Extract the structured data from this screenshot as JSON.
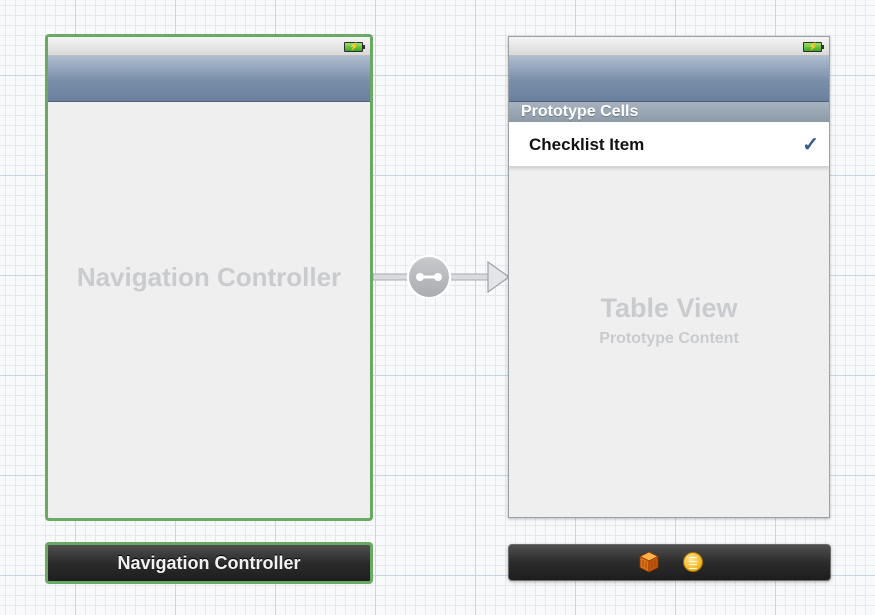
{
  "scenes": {
    "navigation_controller": {
      "title": "Navigation Controller",
      "dock_label": "Navigation Controller",
      "selected": true
    },
    "table_view_controller": {
      "section_header": "Prototype Cells",
      "cell_label": "Checklist Item",
      "cell_accessory": "✓",
      "placeholder_title": "Table View",
      "placeholder_subtitle": "Prototype Content",
      "dock_icons": [
        "view-controller-cube-icon",
        "first-responder-icon"
      ]
    }
  },
  "segue": {
    "type": "relationship",
    "icon": "segue-link-icon"
  },
  "colors": {
    "selection_border": "#6aa964",
    "nav_bar": "#7a8faa",
    "checkmark": "#3a5a8c",
    "placeholder_text": "#c9cbce"
  }
}
